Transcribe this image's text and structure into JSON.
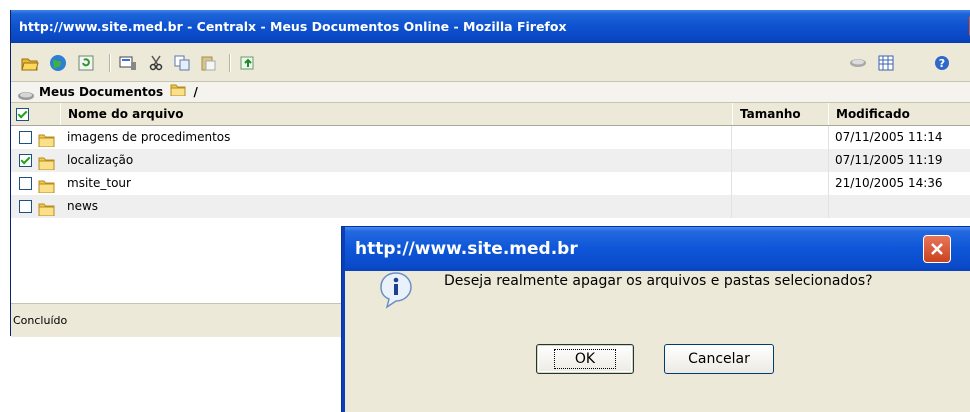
{
  "window": {
    "title": "http://www.site.med.br - Centralx - Meus Documentos Online - Mozilla Firefox"
  },
  "toolbar": {
    "icons": [
      "open-folder-icon",
      "globe-icon",
      "refresh-icon",
      "properties-icon",
      "cut-icon",
      "copy-icon",
      "paste-icon",
      "upload-icon",
      "link-icon",
      "grid-view-icon",
      "help-icon"
    ]
  },
  "path": {
    "root": "Meus Documentos",
    "separator": "/"
  },
  "table": {
    "headers": {
      "name": "Nome do arquivo",
      "size": "Tamanho",
      "modified": "Modificado"
    },
    "rows": [
      {
        "name": "imagens de procedimentos",
        "size": "",
        "modified": "07/11/2005 11:14",
        "checked": false
      },
      {
        "name": "localização",
        "size": "",
        "modified": "07/11/2005 11:19",
        "checked": true
      },
      {
        "name": "msite_tour",
        "size": "",
        "modified": "21/10/2005 14:36",
        "checked": false
      },
      {
        "name": "news",
        "size": "",
        "modified": "",
        "checked": false
      }
    ]
  },
  "status": {
    "text": "Concluído"
  },
  "dialog": {
    "title": "http://www.site.med.br",
    "message": "Deseja realmente apagar os arquivos e pastas selecionados?",
    "ok_label": "OK",
    "cancel_label": "Cancelar"
  },
  "colors": {
    "titlebar": "#0a47c2",
    "close_red": "#d9542a",
    "folder": "#f2c94c",
    "check_green": "#21a121"
  }
}
